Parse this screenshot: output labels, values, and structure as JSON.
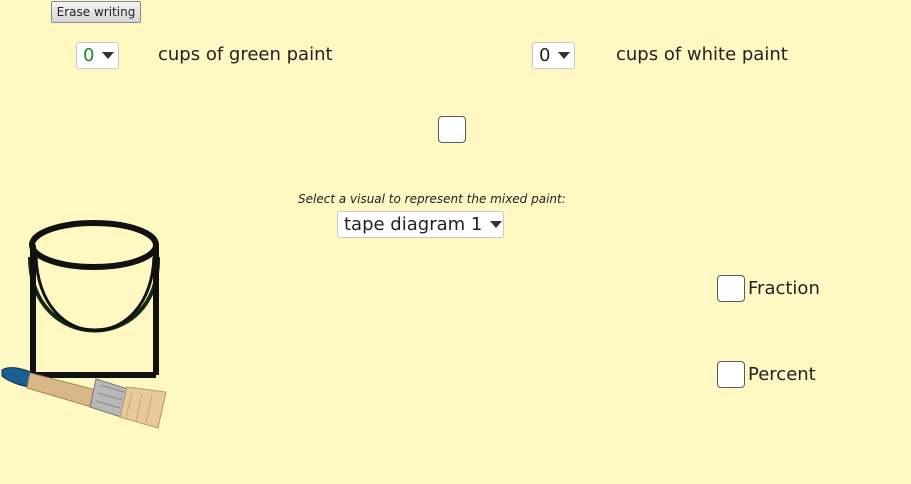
{
  "toolbar": {
    "erase_label": "Erase writing"
  },
  "green_paint": {
    "value": "0",
    "label": "cups of green paint",
    "value_color": "#1e8a1e"
  },
  "white_paint": {
    "value": "0",
    "label": "cups of white paint"
  },
  "visual": {
    "prompt": "Select a visual to represent the mixed paint:",
    "selected": "tape diagram 1"
  },
  "options": {
    "fraction_label": "Fraction",
    "percent_label": "Percent"
  },
  "illustration": {
    "bucket_icon": "paint-bucket-icon",
    "brush_icon": "paintbrush-icon"
  },
  "colors": {
    "background": "#fff8c2",
    "bucket_stroke": "#111111",
    "bucket_inner": "#0f2a0f",
    "brush_handle": "#d8b887",
    "brush_ferrule": "#b8b8b8",
    "brush_tip": "#1b5e96"
  }
}
